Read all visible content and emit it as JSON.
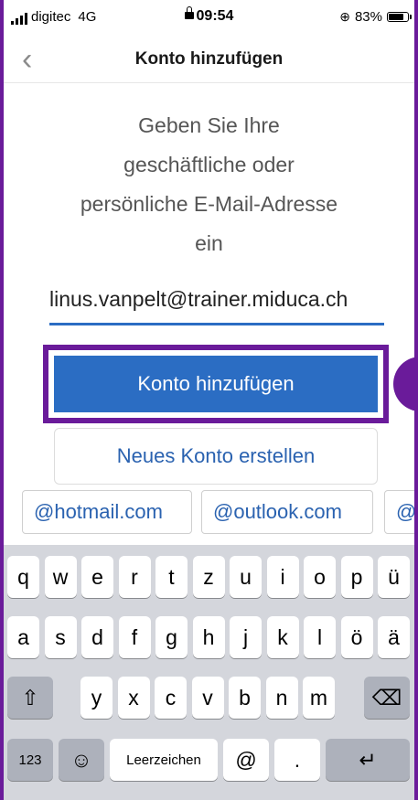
{
  "status_bar": {
    "carrier": "digitec",
    "network": "4G",
    "time": "09:54",
    "battery_text": "83%",
    "battery_level": 0.83
  },
  "nav": {
    "title": "Konto hinzufügen",
    "back_icon": "chevron-left-icon"
  },
  "prompt": "Geben Sie Ihre\ngeschäftliche oder\npersönliche E-Mail-Adresse\nein",
  "email": {
    "value": "linus.vanpelt@trainer.miduca.ch"
  },
  "buttons": {
    "add_account": "Konto hinzufügen",
    "create_account": "Neues Konto erstellen"
  },
  "suggestions": [
    "@hotmail.com",
    "@outlook.com",
    "@g"
  ],
  "keyboard": {
    "row1": [
      "q",
      "w",
      "e",
      "r",
      "t",
      "z",
      "u",
      "i",
      "o",
      "p",
      "ü"
    ],
    "row2": [
      "a",
      "s",
      "d",
      "f",
      "g",
      "h",
      "j",
      "k",
      "l",
      "ö",
      "ä"
    ],
    "row3": [
      "y",
      "x",
      "c",
      "v",
      "b",
      "n",
      "m"
    ],
    "shift_symbol": "⇧",
    "delete_symbol": "⌫",
    "numbers": "123",
    "emoji_symbol": "☺",
    "space": "Leerzeichen",
    "at": "@",
    "dot": ".",
    "return_symbol": "↵"
  },
  "colors": {
    "accent": "#2b6dc3",
    "highlight": "#6a1b9a"
  }
}
